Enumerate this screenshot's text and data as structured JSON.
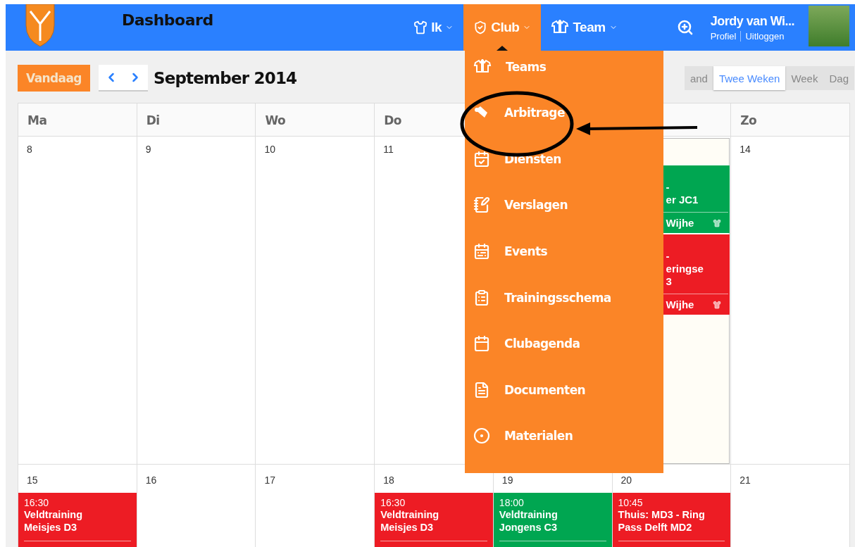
{
  "header": {
    "title": "Dashboard",
    "nav": [
      {
        "label": "Ik",
        "selected": false
      },
      {
        "label": "Club",
        "selected": true
      },
      {
        "label": "Team",
        "selected": false
      }
    ],
    "user": {
      "name": "Jordy van Wi...",
      "links": [
        "Profiel",
        "Uitloggen"
      ]
    }
  },
  "club_menu": {
    "items": [
      {
        "label": "Teams"
      },
      {
        "label": "Arbitrage"
      },
      {
        "label": "Diensten"
      },
      {
        "label": "Verslagen"
      },
      {
        "label": "Events"
      },
      {
        "label": "Trainingsschema"
      },
      {
        "label": "Clubagenda"
      },
      {
        "label": "Documenten"
      },
      {
        "label": "Materialen"
      }
    ]
  },
  "toolbar": {
    "today": "Vandaag",
    "month": "September 2014",
    "views": [
      {
        "label": "and",
        "selected": false
      },
      {
        "label": "Twee Weken",
        "selected": true
      },
      {
        "label": "Week",
        "selected": false
      },
      {
        "label": "Dag",
        "selected": false
      }
    ]
  },
  "calendar": {
    "weeks": [
      {
        "days": [
          {
            "kind": "day",
            "weekday": "Ma",
            "date": "8",
            "today": false
          },
          {
            "kind": "day",
            "weekday": "Di",
            "date": "9",
            "today": false
          },
          {
            "kind": "day",
            "weekday": "Wo",
            "date": "10",
            "today": false
          },
          {
            "kind": "day",
            "weekday": "Do",
            "date": "11",
            "today": false
          },
          {
            "kind": "covered"
          },
          {
            "kind": "day",
            "today": true,
            "events": [
              {
                "kind": "partial",
                "color": "#00a651",
                "lines": [
                  "-",
                  "er JC1"
                ],
                "location": "Wijhe"
              },
              {
                "kind": "partial",
                "color": "#ed1c24",
                "lines": [
                  "-",
                  "eringse",
                  "3"
                ],
                "location": "Wijhe"
              }
            ]
          },
          {
            "kind": "day",
            "weekday": "Zo",
            "date": "14",
            "today": false
          }
        ]
      },
      {
        "days": [
          {
            "kind": "day",
            "date": "15",
            "today": false,
            "events": [
              {
                "kind": "full",
                "color": "#ed1c24",
                "time": "16:30",
                "title": "Veldtraining Meisjes D3"
              }
            ]
          },
          {
            "kind": "day",
            "date": "16",
            "today": false
          },
          {
            "kind": "day",
            "date": "17",
            "today": false
          },
          {
            "kind": "day",
            "date": "18",
            "today": false,
            "events": [
              {
                "kind": "full",
                "color": "#ed1c24",
                "time": "16:30",
                "title": "Veldtraining Meisjes D3"
              }
            ]
          },
          {
            "kind": "day",
            "date": "19",
            "today": false,
            "events": [
              {
                "kind": "full",
                "color": "#00a651",
                "time": "18:00",
                "title": "Veldtraining Jongens C3"
              }
            ]
          },
          {
            "kind": "day",
            "date": "20",
            "today": false,
            "events": [
              {
                "kind": "full",
                "color": "#ed1c24",
                "time": "10:45",
                "title": "Thuis: MD3 - Ring Pass Delft MD2"
              }
            ]
          },
          {
            "kind": "day",
            "date": "21",
            "today": false
          }
        ]
      }
    ]
  }
}
